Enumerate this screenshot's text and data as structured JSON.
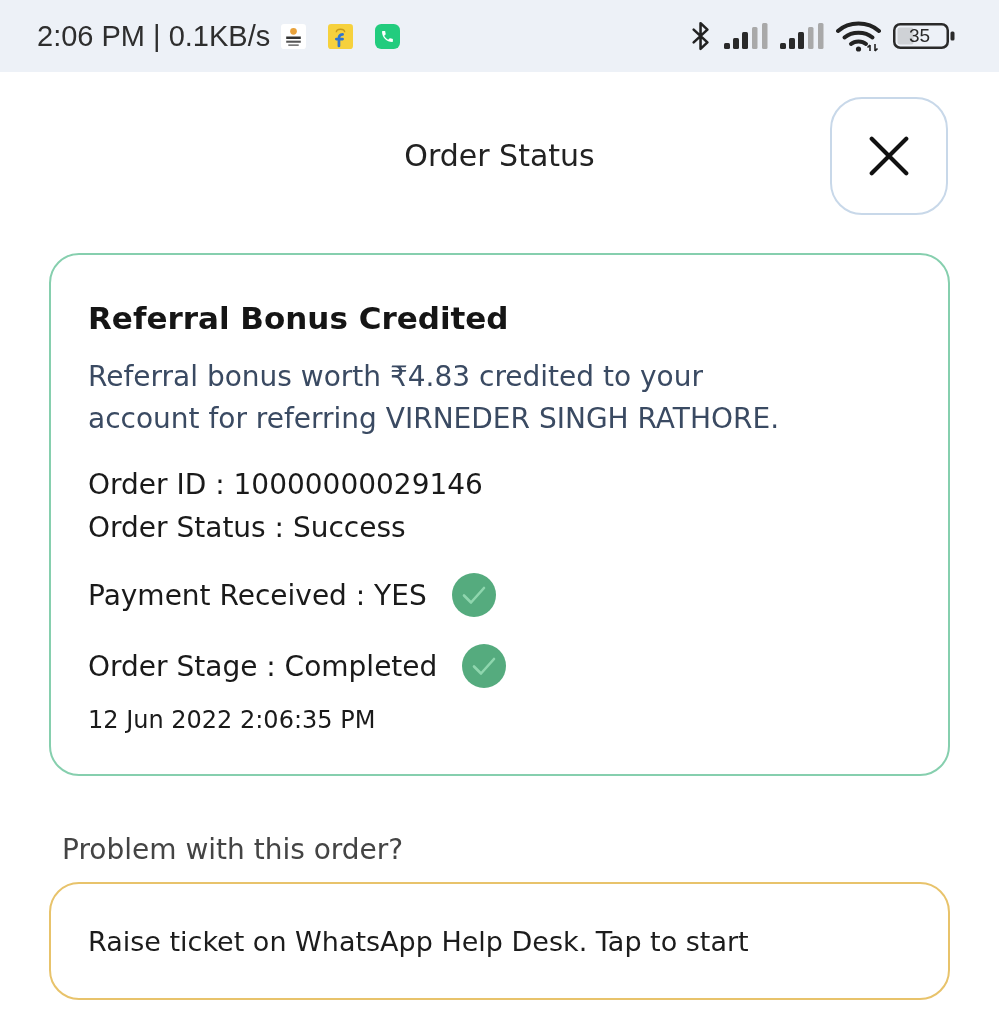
{
  "status_bar": {
    "time_speed": "2:06 PM | 0.1KB/s",
    "battery": "35"
  },
  "header": {
    "title": "Order Status"
  },
  "card": {
    "title": "Referral Bonus Credited",
    "description": "Referral bonus worth ₹4.83 credited to your account for referring VIRNEDER SINGH RATHORE.",
    "details": [
      {
        "text": "Order ID : 10000000029146",
        "verified": false
      },
      {
        "text": "Order Status : Success",
        "verified": false
      },
      {
        "text": "Payment Received : YES",
        "verified": true
      },
      {
        "text": "Order Stage : Completed",
        "verified": true
      }
    ],
    "timestamp": "12 Jun 2022 2:06:35 PM"
  },
  "help": {
    "prompt": "Problem with this order?",
    "button": "Raise ticket on WhatsApp Help Desk. Tap to start"
  }
}
